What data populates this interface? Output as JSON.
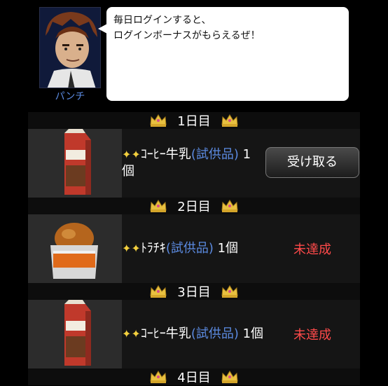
{
  "character": {
    "name": "パンチ",
    "message_line1": "毎日ログインすると、",
    "message_line2": "ログインボーナスがもらえるぜ！"
  },
  "days": [
    {
      "label": "1日目",
      "item_prefix": "✦✦",
      "item_name": "ｺｰﾋｰ牛乳",
      "item_tag": "(試供品)",
      "item_qty": " 1個",
      "product": "coffee-milk",
      "action_label": "受け取る"
    },
    {
      "label": "2日目",
      "item_prefix": "✦✦",
      "item_name": "ﾄﾗﾁｷ",
      "item_tag": "(試供品)",
      "item_qty": " 1個",
      "product": "fried-chicken",
      "status_label": "未達成"
    },
    {
      "label": "3日目",
      "item_prefix": "✦✦",
      "item_name": "ｺｰﾋｰ牛乳",
      "item_tag": "(試供品)",
      "item_qty": " 1個",
      "product": "coffee-milk",
      "status_label": "未達成"
    },
    {
      "label": "4日目"
    }
  ],
  "colors": {
    "highlight": "#5b8ae0",
    "not_achieved": "#ff4a4a",
    "crown": "#e8c040"
  },
  "icons": {
    "crown": "crown-icon",
    "sparkle": "sparkle-icon"
  }
}
